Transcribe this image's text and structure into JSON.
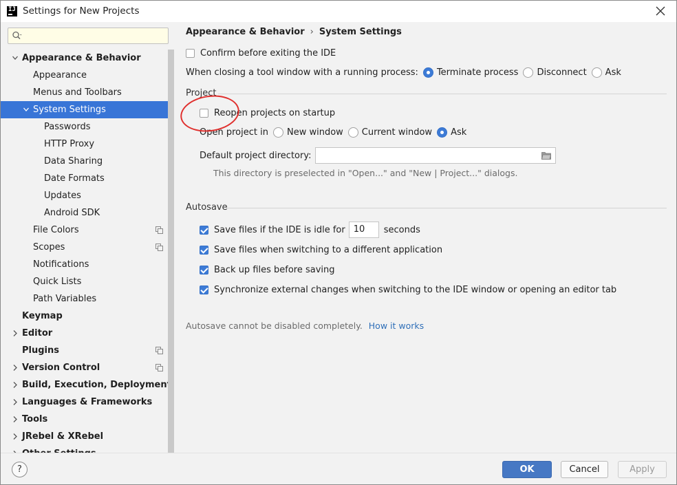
{
  "window": {
    "title": "Settings for New Projects",
    "app_icon_text": "IJ"
  },
  "sidebar": {
    "search": {
      "value": "",
      "placeholder": ""
    },
    "items": [
      {
        "label": "Appearance & Behavior",
        "level": 0,
        "expanded": true,
        "bold": true
      },
      {
        "label": "Appearance",
        "level": 1
      },
      {
        "label": "Menus and Toolbars",
        "level": 1
      },
      {
        "label": "System Settings",
        "level": 1,
        "expanded": true,
        "selected": true
      },
      {
        "label": "Passwords",
        "level": 2
      },
      {
        "label": "HTTP Proxy",
        "level": 2
      },
      {
        "label": "Data Sharing",
        "level": 2
      },
      {
        "label": "Date Formats",
        "level": 2
      },
      {
        "label": "Updates",
        "level": 2
      },
      {
        "label": "Android SDK",
        "level": 2
      },
      {
        "label": "File Colors",
        "level": 1,
        "project_icon": true
      },
      {
        "label": "Scopes",
        "level": 1,
        "project_icon": true
      },
      {
        "label": "Notifications",
        "level": 1
      },
      {
        "label": "Quick Lists",
        "level": 1
      },
      {
        "label": "Path Variables",
        "level": 1
      },
      {
        "label": "Keymap",
        "level": 0,
        "bold": true
      },
      {
        "label": "Editor",
        "level": 0,
        "collapsed": true,
        "bold": true
      },
      {
        "label": "Plugins",
        "level": 0,
        "bold": true,
        "project_icon": true
      },
      {
        "label": "Version Control",
        "level": 0,
        "collapsed": true,
        "bold": true,
        "project_icon": true
      },
      {
        "label": "Build, Execution, Deployment",
        "level": 0,
        "collapsed": true,
        "bold": true
      },
      {
        "label": "Languages & Frameworks",
        "level": 0,
        "collapsed": true,
        "bold": true
      },
      {
        "label": "Tools",
        "level": 0,
        "collapsed": true,
        "bold": true
      },
      {
        "label": "JRebel & XRebel",
        "level": 0,
        "collapsed": true,
        "bold": true
      },
      {
        "label": "Other Settings",
        "level": 0,
        "collapsed": true,
        "bold": true
      }
    ]
  },
  "main": {
    "breadcrumb": {
      "parent": "Appearance & Behavior",
      "separator": "›",
      "current": "System Settings"
    },
    "confirm_exit": {
      "label": "Confirm before exiting the IDE",
      "checked": false
    },
    "closing_tool_window": {
      "label": "When closing a tool window with a running process:",
      "options": [
        "Terminate process",
        "Disconnect",
        "Ask"
      ],
      "selected": "Terminate process"
    },
    "project_section": {
      "title": "Project",
      "reopen": {
        "label": "Reopen projects on startup",
        "checked": false
      },
      "open_in": {
        "label": "Open project in",
        "options": [
          "New window",
          "Current window",
          "Ask"
        ],
        "selected": "Ask"
      },
      "default_dir": {
        "label": "Default project directory:",
        "value": ""
      },
      "hint": "This directory is preselected in \"Open...\" and \"New | Project...\" dialogs."
    },
    "autosave_section": {
      "title": "Autosave",
      "idle": {
        "label": "Save files if the IDE is idle for",
        "value": "10",
        "unit": "seconds",
        "checked": true
      },
      "switching": {
        "label": "Save files when switching to a different application",
        "checked": true
      },
      "backup": {
        "label": "Back up files before saving",
        "checked": true
      },
      "sync": {
        "label": "Synchronize external changes when switching to the IDE window or opening an editor tab",
        "checked": true
      },
      "note": "Autosave cannot be disabled completely.",
      "note_link": "How it works"
    }
  },
  "footer": {
    "help_label": "?",
    "ok_label": "OK",
    "cancel_label": "Cancel",
    "apply_label": "Apply"
  },
  "colors": {
    "accent": "#3875d7",
    "annotation": "#e0302e",
    "link": "#2f6fb8"
  }
}
